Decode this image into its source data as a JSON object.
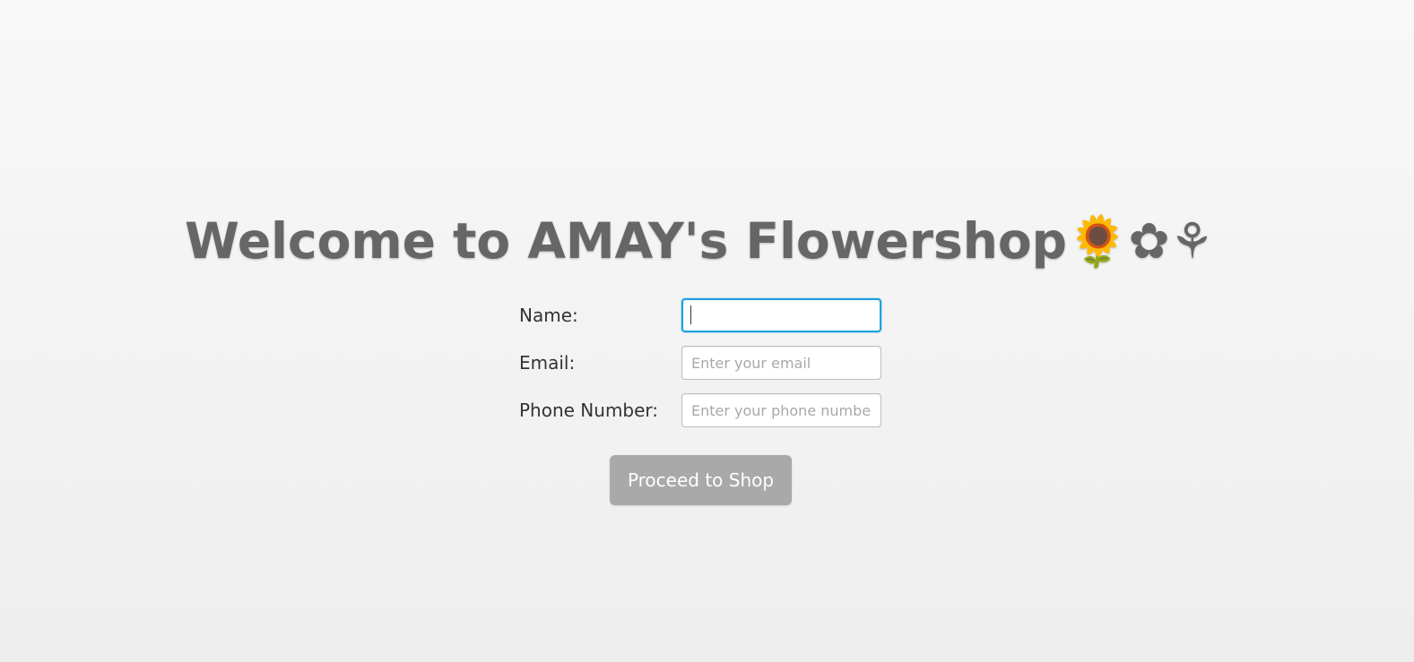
{
  "header": {
    "title": "Welcome to AMAY's Flowershop🌻✿⚘"
  },
  "form": {
    "name": {
      "label": "Name:",
      "value": "",
      "placeholder": ""
    },
    "email": {
      "label": "Email:",
      "value": "",
      "placeholder": "Enter your email"
    },
    "phone": {
      "label": "Phone Number:",
      "value": "",
      "placeholder": "Enter your phone number"
    },
    "submit_label": "Proceed to Shop"
  },
  "colors": {
    "title": "#666666",
    "focus_border": "#1da1de",
    "button_bg": "#a9a9a9",
    "button_text": "#ffffff"
  }
}
